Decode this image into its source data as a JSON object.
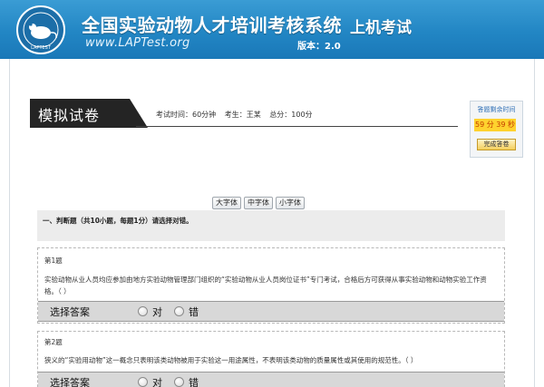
{
  "header": {
    "title": "全国实验动物人才培训考核系统",
    "mode": "上机考试",
    "url": "www.LAPTest.org",
    "version": "版本：2.0"
  },
  "exam": {
    "title": "模拟试卷",
    "time_label": "考试时间：60分钟",
    "examinee_label": "考生：王某",
    "score_label": "总分：100分"
  },
  "timer": {
    "label": "答题剩余时间",
    "value": "59 分 39 秒",
    "finish_label": "完成答卷"
  },
  "font_buttons": [
    "大字体",
    "中字体",
    "小字体"
  ],
  "section": {
    "title": "一、判断题（共10小题，每题1分）请选择对错。"
  },
  "questions": [
    {
      "number": "第1题",
      "text": "实验动物从业人员均应参加由地方实验动物管理部门组织的“实验动物从业人员岗位证书”专门考试，合格后方可获得从事实验动物和动物实验工作资格。（    ）",
      "answer_label": "选择答案",
      "options": [
        "对",
        "错"
      ]
    },
    {
      "number": "第2题",
      "text": "狭义的“实验用动物”这一概念只表明该类动物被用于实验这一用途属性，不表明该类动物的质量属性或其使用的规范性。（    ）",
      "answer_label": "选择答案",
      "options": [
        "对",
        "错"
      ]
    }
  ],
  "colors": {
    "header_blue": "#2286c4",
    "timer_yellow": "#ffd22e",
    "title_black": "#242424"
  }
}
